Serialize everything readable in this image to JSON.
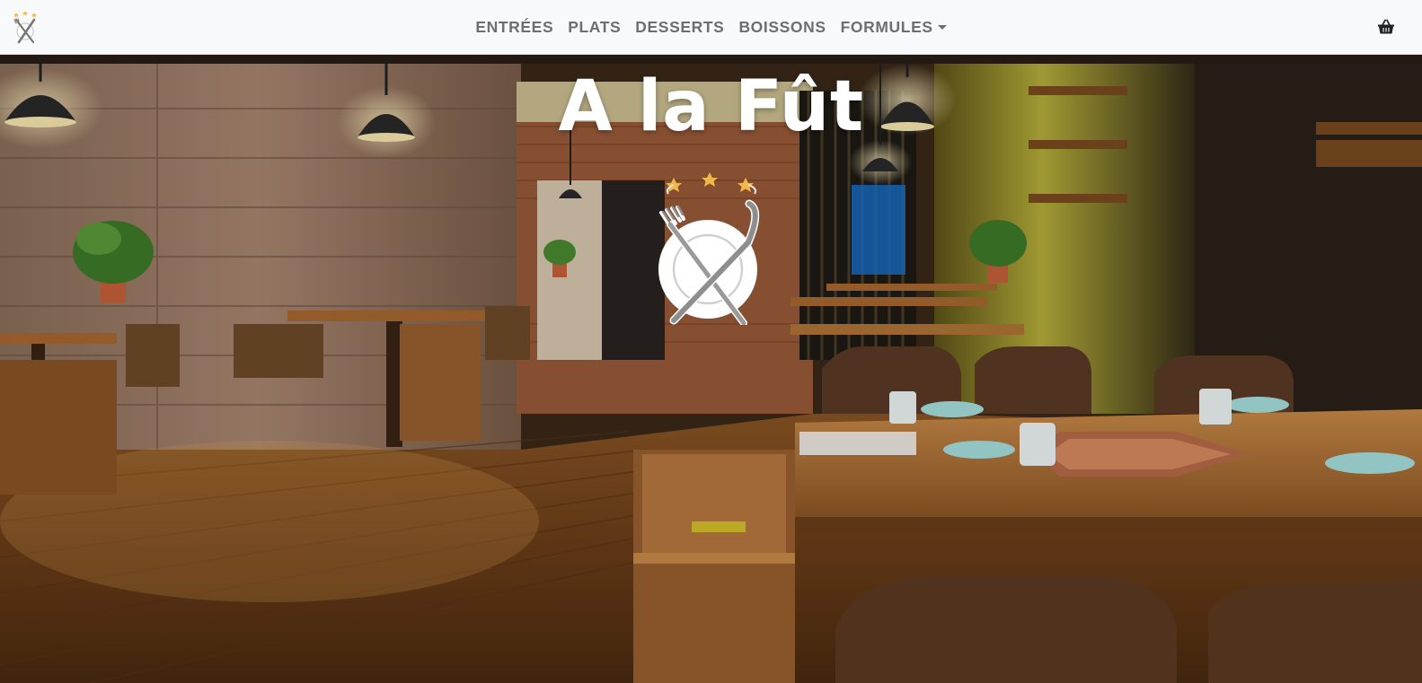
{
  "navbar": {
    "brand_icon": "fork-knife-stars-icon",
    "links": [
      {
        "label": "ENTRÉES"
      },
      {
        "label": "PLATS"
      },
      {
        "label": "DESSERTS"
      },
      {
        "label": "BOISSONS"
      },
      {
        "label": "FORMULES",
        "dropdown": true
      }
    ],
    "cart_icon": "shopping-basket-icon"
  },
  "hero": {
    "title": "A la Fût",
    "logo_icon": "plate-fork-knife-stars-icon",
    "background": "restaurant-interior-photo"
  },
  "colors": {
    "navbar_bg": "#f8f9fa",
    "nav_text": "#6b6f73",
    "hero_title": "#ffffff",
    "star_gold": "#f0b84a"
  }
}
